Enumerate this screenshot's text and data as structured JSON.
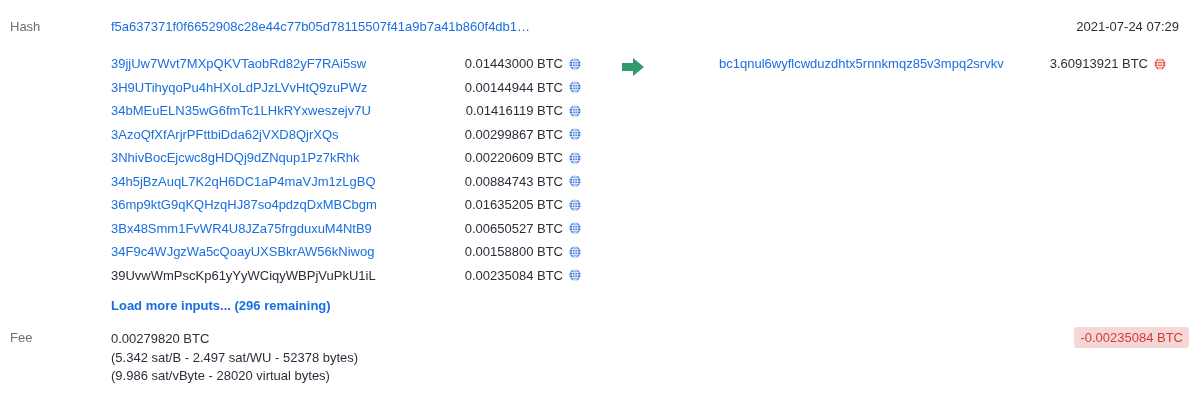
{
  "hash_row": {
    "label": "Hash",
    "hash": "f5a637371f0f6652908c28e44c77b05d78115507f41a9b7a41b860f4db1…",
    "time": "2021-07-24 07:29"
  },
  "inputs": [
    {
      "address": "39jjUw7Wvt7MXpQKVTaobRd82yF7RAi5sw",
      "amount": "0.01443000 BTC",
      "current": false,
      "spent": false
    },
    {
      "address": "3H9UTihyqoPu4hHXoLdPJzLVvHtQ9zuPWz",
      "amount": "0.00144944 BTC",
      "current": false,
      "spent": false
    },
    {
      "address": "34bMEuELN35wG6fmTc1LHkRYxweszejv7U",
      "amount": "0.01416119 BTC",
      "current": false,
      "spent": false
    },
    {
      "address": "3AzoQfXfArjrPFttbiDda62jVXD8QjrXQs",
      "amount": "0.00299867 BTC",
      "current": false,
      "spent": false
    },
    {
      "address": "3NhivBocEjcwc8gHDQj9dZNqup1Pz7kRhk",
      "amount": "0.00220609 BTC",
      "current": false,
      "spent": false
    },
    {
      "address": "34h5jBzAuqL7K2qH6DC1aP4maVJm1zLgBQ",
      "amount": "0.00884743 BTC",
      "current": false,
      "spent": false
    },
    {
      "address": "36mp9ktG9qKQHzqHJ87so4pdzqDxMBCbgm",
      "amount": "0.01635205 BTC",
      "current": false,
      "spent": false
    },
    {
      "address": "3Bx48Smm1FvWR4U8JZa75frgduxuM4NtB9",
      "amount": "0.00650527 BTC",
      "current": false,
      "spent": false
    },
    {
      "address": "34F9c4WJgzWa5cQoayUXSBkrAW56kNiwog",
      "amount": "0.00158800 BTC",
      "current": false,
      "spent": false
    },
    {
      "address": "39UvwWmPscKp61yYyWCiqyWBPjVuPkU1iL",
      "amount": "0.00235084 BTC",
      "current": true,
      "spent": false
    }
  ],
  "load_more": "Load more inputs... (296 remaining)",
  "outputs": [
    {
      "address": "bc1qnul6wyflcwduzdhtx5rnnkmqz85v3mpq2srvkv",
      "amount": "3.60913921 BTC",
      "current": false,
      "spent": true
    }
  ],
  "fee_row": {
    "label": "Fee",
    "amount": "0.00279820 BTC",
    "details": [
      "(5.342 sat/B - 2.497 sat/WU - 52378 bytes)",
      "(9.986 sat/vByte - 28020 virtual bytes)"
    ],
    "balance": "-0.00235084 BTC"
  }
}
